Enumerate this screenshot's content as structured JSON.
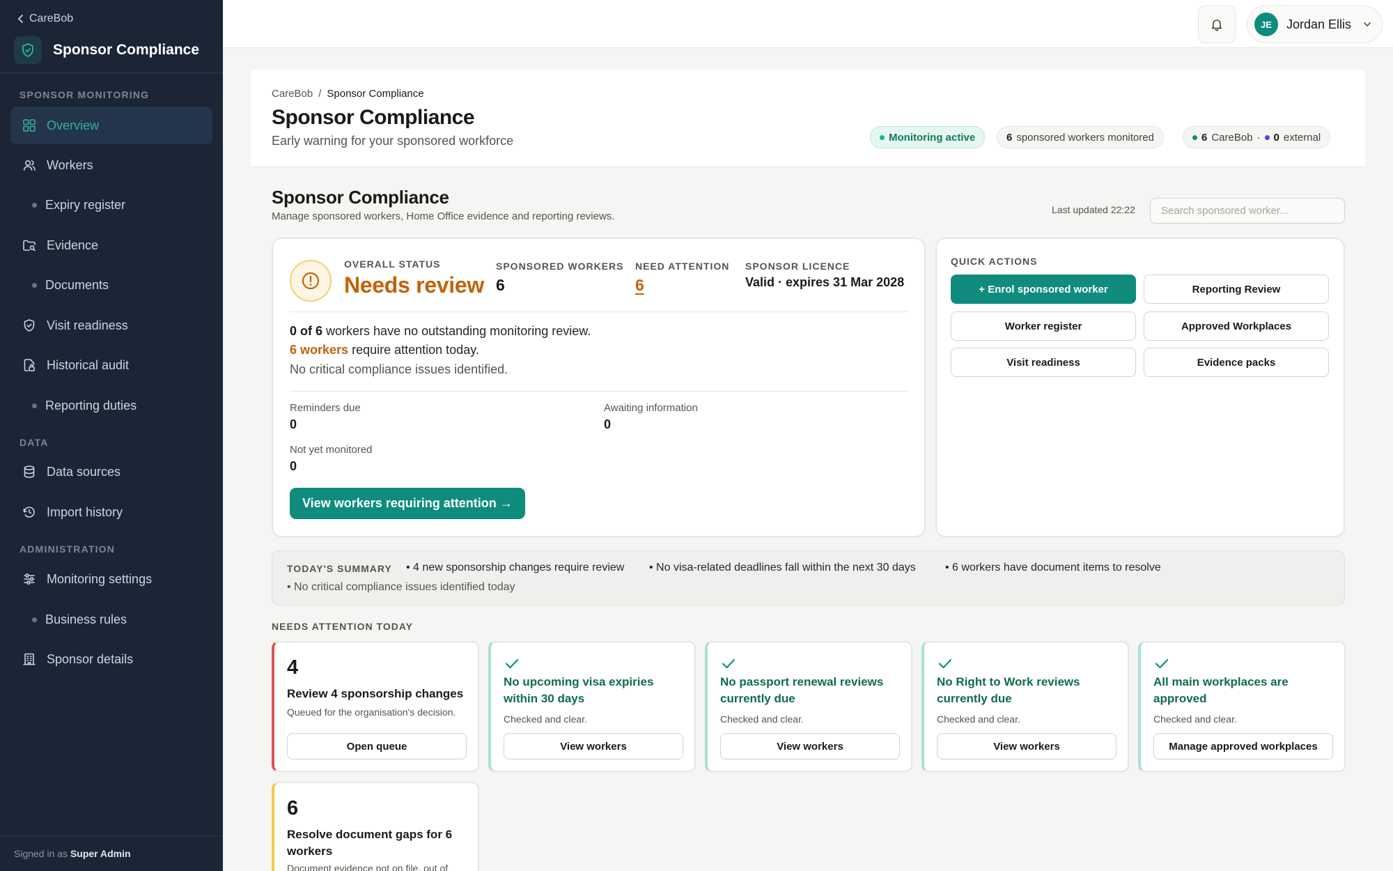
{
  "sidebar": {
    "back_label": "CareBob",
    "brand_title": "Sponsor Compliance",
    "sections": {
      "monitoring": "SPONSOR MONITORING",
      "data": "DATA",
      "administration": "ADMINISTRATION"
    },
    "items": {
      "overview": "Overview",
      "workers": "Workers",
      "expiry_register": "Expiry register",
      "evidence": "Evidence",
      "documents": "Documents",
      "visit_readiness": "Visit readiness",
      "historical_audit": "Historical audit",
      "reporting_duties": "Reporting duties",
      "data_sources": "Data sources",
      "import_history": "Import history",
      "monitoring_settings": "Monitoring settings",
      "business_rules": "Business rules",
      "sponsor_details": "Sponsor details"
    },
    "signed_in_prefix": "Signed in as",
    "signed_in_user": "Super Admin"
  },
  "topbar": {
    "user_initials": "JE",
    "user_name": "Jordan Ellis"
  },
  "header": {
    "breadcrumb_root": "CareBob",
    "breadcrumb_sep": "/",
    "breadcrumb_current": "Sponsor Compliance",
    "title": "Sponsor Compliance",
    "subtitle": "Early warning for your sponsored workforce",
    "pill_monitoring": "Monitoring active",
    "pill_workers_count": "6",
    "pill_workers_text": "sponsored workers monitored",
    "pill_carebob_count": "6",
    "pill_carebob_label": "CareBob",
    "pill_sep": "·",
    "pill_external_count": "0",
    "pill_external_label": "external"
  },
  "section": {
    "title": "Sponsor Compliance",
    "subtitle": "Manage sponsored workers, Home Office evidence and reporting reviews.",
    "last_updated": "Last updated 22:22",
    "search_placeholder": "Search sponsored worker..."
  },
  "status": {
    "overall_label": "OVERALL STATUS",
    "overall_value": "Needs review",
    "workers_label": "SPONSORED WORKERS",
    "workers_value": "6",
    "attention_label": "NEED ATTENTION",
    "attention_value": "6",
    "licence_label": "SPONSOR LICENCE",
    "licence_value": "Valid · expires 31 Mar 2028",
    "line1_bold": "0 of 6",
    "line1_rest": "workers have no outstanding monitoring review.",
    "line2_bold": "6 workers",
    "line2_rest": "require attention today.",
    "line3": "No critical compliance issues identified.",
    "reminders_label": "Reminders due",
    "reminders_value": "0",
    "awaiting_label": "Awaiting information",
    "awaiting_value": "0",
    "not_monitored_label": "Not yet monitored",
    "not_monitored_value": "0",
    "cta": "View workers requiring attention →"
  },
  "quick_actions": {
    "title": "QUICK ACTIONS",
    "enrol": "+ Enrol sponsored worker",
    "reporting_review": "Reporting Review",
    "worker_register": "Worker register",
    "approved_workplaces": "Approved Workplaces",
    "visit_readiness": "Visit readiness",
    "evidence_packs": "Evidence packs"
  },
  "summary": {
    "label": "TODAY'S SUMMARY",
    "items": [
      "• 4 new sponsorship changes require review",
      "• No visa-related deadlines fall within the next 30 days",
      "• 6 workers have document items to resolve",
      "• No critical compliance issues identified today"
    ]
  },
  "attention": {
    "label": "NEEDS ATTENTION TODAY",
    "cards": [
      {
        "number": "4",
        "title": "Review 4 sponsorship changes",
        "desc": "Queued for the organisation's decision.",
        "button": "Open queue"
      },
      {
        "title": "No upcoming visa expiries within 30 days",
        "desc": "Checked and clear.",
        "button": "View workers"
      },
      {
        "title": "No passport renewal reviews currently due",
        "desc": "Checked and clear.",
        "button": "View workers"
      },
      {
        "title": "No Right to Work reviews currently due",
        "desc": "Checked and clear.",
        "button": "View workers"
      },
      {
        "title": "All main workplaces are approved",
        "desc": "Checked and clear.",
        "button": "Manage approved workplaces"
      },
      {
        "number": "6",
        "title": "Resolve document gaps for 6 workers",
        "desc": "Document evidence not on file, out of"
      }
    ]
  },
  "colors": {
    "sidebar_bg": "#1b2535",
    "accent": "#0f8c7e",
    "warning": "#c2620a",
    "alert_red": "#e05252",
    "alert_yellow": "#f2c94c"
  }
}
